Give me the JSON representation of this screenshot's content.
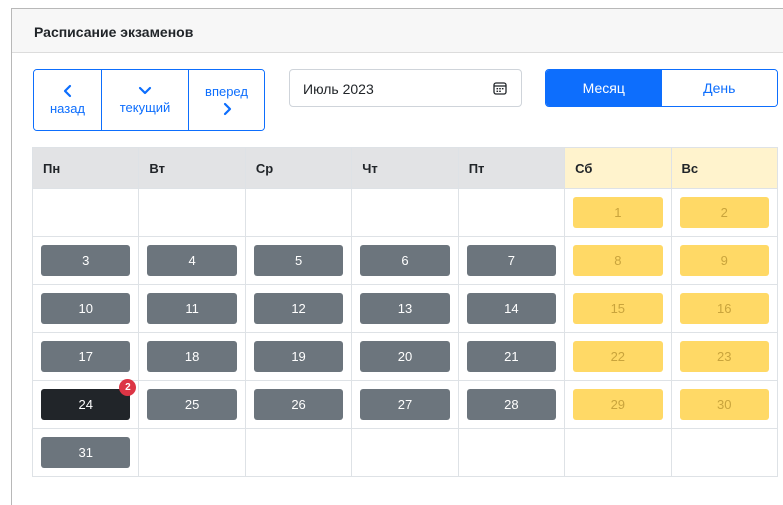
{
  "header": {
    "title": "Расписание экзаменов"
  },
  "nav": {
    "prev_label": "назад",
    "today_label": "текущий",
    "next_label": "вперед"
  },
  "month_picker": {
    "value": "Июль 2023",
    "icon": "calendar-icon"
  },
  "view_switch": {
    "month_label": "Месяц",
    "day_label": "День",
    "active": "month"
  },
  "calendar": {
    "weekdays": [
      "Пн",
      "Вт",
      "Ср",
      "Чт",
      "Пт",
      "Сб",
      "Вс"
    ],
    "weeks": [
      [
        null,
        null,
        null,
        null,
        null,
        "1",
        "2"
      ],
      [
        "3",
        "4",
        "5",
        "6",
        "7",
        "8",
        "9"
      ],
      [
        "10",
        "11",
        "12",
        "13",
        "14",
        "15",
        "16"
      ],
      [
        "17",
        "18",
        "19",
        "20",
        "21",
        "22",
        "23"
      ],
      [
        "24",
        "25",
        "26",
        "27",
        "28",
        "29",
        "30"
      ],
      [
        "31",
        null,
        null,
        null,
        null,
        null,
        null
      ]
    ],
    "today": "24",
    "today_badge": "2"
  },
  "colors": {
    "primary": "#0d6efd",
    "workday": "#6c757d",
    "weekend": "#ffd966",
    "weekend_header": "#fff3cd",
    "today": "#212529",
    "badge": "#dc3545"
  }
}
